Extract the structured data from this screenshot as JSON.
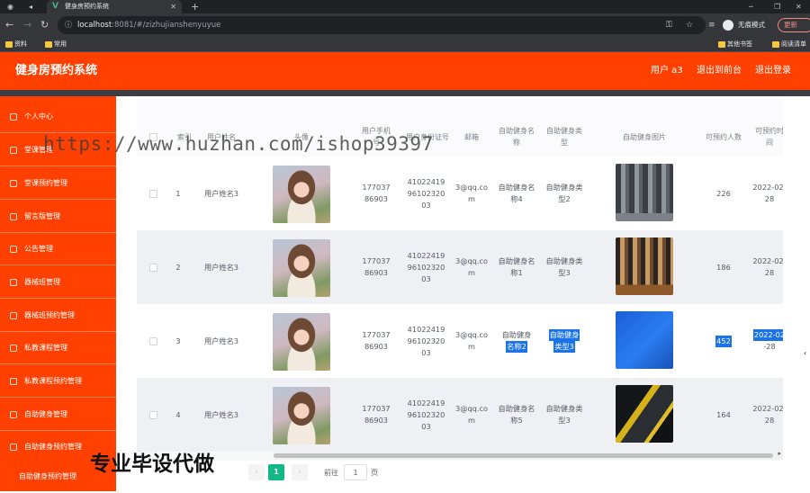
{
  "browser": {
    "tab_title": "健身房预约系统",
    "url_host": "localhost",
    "url_path": ":8081/#/zizhujianshenyuyue",
    "incognito_label": "无痕模式",
    "update_label": "更新",
    "bookmarks": [
      "资料",
      "常用"
    ],
    "bookmarks_right": [
      "其他书签",
      "阅读清单"
    ]
  },
  "header": {
    "title": "健身房预约系统",
    "user": "用户 a3",
    "back_to_desk": "退出到前台",
    "logout": "退出登录",
    "accent": "#ff4000"
  },
  "sidebar": {
    "items": [
      {
        "label": "个人中心"
      },
      {
        "label": "堂课管理"
      },
      {
        "label": "堂课预约管理"
      },
      {
        "label": "留言版管理"
      },
      {
        "label": "公告管理"
      },
      {
        "label": "器械班管理"
      },
      {
        "label": "器械班预约管理"
      },
      {
        "label": "私教课程管理"
      },
      {
        "label": "私教课程预约管理"
      },
      {
        "label": "自助健身管理"
      },
      {
        "label": "自助健身预约管理"
      }
    ],
    "sub_item": "自助健身预约管理"
  },
  "table": {
    "headers": {
      "index": "索引",
      "name": "用户姓名",
      "avatar": "头像",
      "phone": "用户手机号",
      "idcard": "用户身份证号",
      "email": "邮箱",
      "fname": "自助健身名称",
      "ftype": "自助健身类型",
      "fimg": "自助健身图片",
      "count": "可预约人数",
      "time": "可预约时间"
    },
    "rows": [
      {
        "index": "1",
        "name": "用户姓名3",
        "phone": "17703786903",
        "idcard": "410224199610232003",
        "email": "3@qq.com",
        "fname": "自助健身名称4",
        "ftype": "自助健身类型2",
        "count": "226",
        "time": "2022-02-28"
      },
      {
        "index": "2",
        "name": "用户姓名3",
        "phone": "17703786903",
        "idcard": "410224199610232003",
        "email": "3@qq.com",
        "fname": "自助健身名称1",
        "ftype": "自助健身类型3",
        "count": "186",
        "time": "2022-02-28"
      },
      {
        "index": "3",
        "name": "用户姓名3",
        "phone": "17703786903",
        "idcard": "410224199610232003",
        "email": "3@qq.com",
        "fname_a": "自助健身",
        "fname_b": "名称2",
        "ftype_a": "自助健身",
        "ftype_b": "类型3",
        "count": "452",
        "time_a": "2022-02",
        "time_b": "-28"
      },
      {
        "index": "4",
        "name": "用户姓名3",
        "phone": "17703786903",
        "idcard": "410224199610232003",
        "email": "3@qq.com",
        "fname": "自助健身名称5",
        "ftype": "自助健身类型3",
        "count": "164",
        "time": "2022-02-28"
      }
    ]
  },
  "pagination": {
    "current": "1",
    "goto_label": "前往",
    "goto_value": "1",
    "page_suffix": "页",
    "active_color": "#12b886"
  },
  "watermark": {
    "url_text": "https://www.huzhan.com/ishop39397",
    "promo_text": "专业毕设代做"
  }
}
